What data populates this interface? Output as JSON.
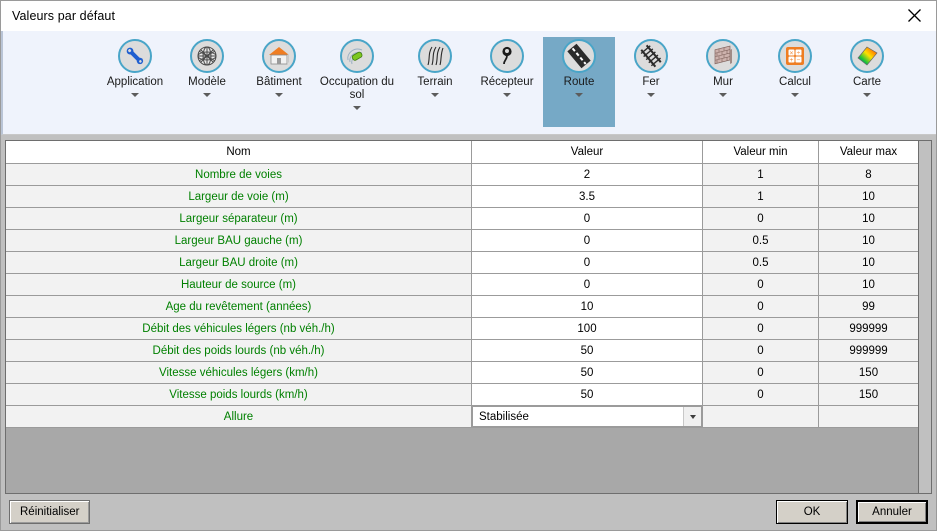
{
  "window": {
    "title": "Valeurs par défaut",
    "close_icon": "close-icon"
  },
  "ribbon": {
    "items": [
      {
        "label": "Application",
        "icon": "wrench-icon",
        "selected": false,
        "has_caret": true
      },
      {
        "label": "Modèle",
        "icon": "globe-mesh-icon",
        "selected": false,
        "has_caret": true
      },
      {
        "label": "Bâtiment",
        "icon": "house-icon",
        "selected": false,
        "has_caret": true
      },
      {
        "label": "Occupation du sol",
        "icon": "landuse-icon",
        "selected": false,
        "has_caret": true
      },
      {
        "label": "Terrain",
        "icon": "contours-icon",
        "selected": false,
        "has_caret": true
      },
      {
        "label": "Récepteur",
        "icon": "microphone-icon",
        "selected": false,
        "has_caret": true
      },
      {
        "label": "Route",
        "icon": "road-icon",
        "selected": true,
        "has_caret": true
      },
      {
        "label": "Fer",
        "icon": "railway-icon",
        "selected": false,
        "has_caret": true
      },
      {
        "label": "Mur",
        "icon": "brickwall-icon",
        "selected": false,
        "has_caret": true
      },
      {
        "label": "Calcul",
        "icon": "calculator-icon",
        "selected": false,
        "has_caret": true
      },
      {
        "label": "Carte",
        "icon": "colormap-icon",
        "selected": false,
        "has_caret": true
      }
    ]
  },
  "table": {
    "columns": [
      "Nom",
      "Valeur",
      "Valeur min",
      "Valeur max"
    ],
    "rows": [
      {
        "name": "Nombre de voies",
        "value": "2",
        "min": "1",
        "max": "8",
        "type": "text"
      },
      {
        "name": "Largeur de voie (m)",
        "value": "3.5",
        "min": "1",
        "max": "10",
        "type": "text"
      },
      {
        "name": "Largeur séparateur (m)",
        "value": "0",
        "min": "0",
        "max": "10",
        "type": "text"
      },
      {
        "name": "Largeur BAU gauche (m)",
        "value": "0",
        "min": "0.5",
        "max": "10",
        "type": "text"
      },
      {
        "name": "Largeur BAU droite (m)",
        "value": "0",
        "min": "0.5",
        "max": "10",
        "type": "text"
      },
      {
        "name": "Hauteur de source (m)",
        "value": "0",
        "min": "0",
        "max": "10",
        "type": "text"
      },
      {
        "name": "Age du revêtement (années)",
        "value": "10",
        "min": "0",
        "max": "99",
        "type": "text"
      },
      {
        "name": "Débit des véhicules légers (nb véh./h)",
        "value": "100",
        "min": "0",
        "max": "999999",
        "type": "text"
      },
      {
        "name": "Débit des poids lourds (nb véh./h)",
        "value": "50",
        "min": "0",
        "max": "999999",
        "type": "text"
      },
      {
        "name": "Vitesse véhicules légers (km/h)",
        "value": "50",
        "min": "0",
        "max": "150",
        "type": "text"
      },
      {
        "name": "Vitesse poids lourds (km/h)",
        "value": "50",
        "min": "0",
        "max": "150",
        "type": "text"
      },
      {
        "name": "Allure",
        "value": "Stabilisée",
        "min": "",
        "max": "",
        "type": "select"
      }
    ]
  },
  "footer": {
    "reset_label": "Réinitialiser",
    "ok_label": "OK",
    "cancel_label": "Annuler"
  },
  "colors": {
    "ribbon_bg": "#eff3fc",
    "selected_tab": "#76a9c6",
    "name_text": "#008000",
    "grid_empty": "#a8a8a8",
    "dialog_bg": "#c0c0c0",
    "icon_ring": "#49a5c8"
  }
}
